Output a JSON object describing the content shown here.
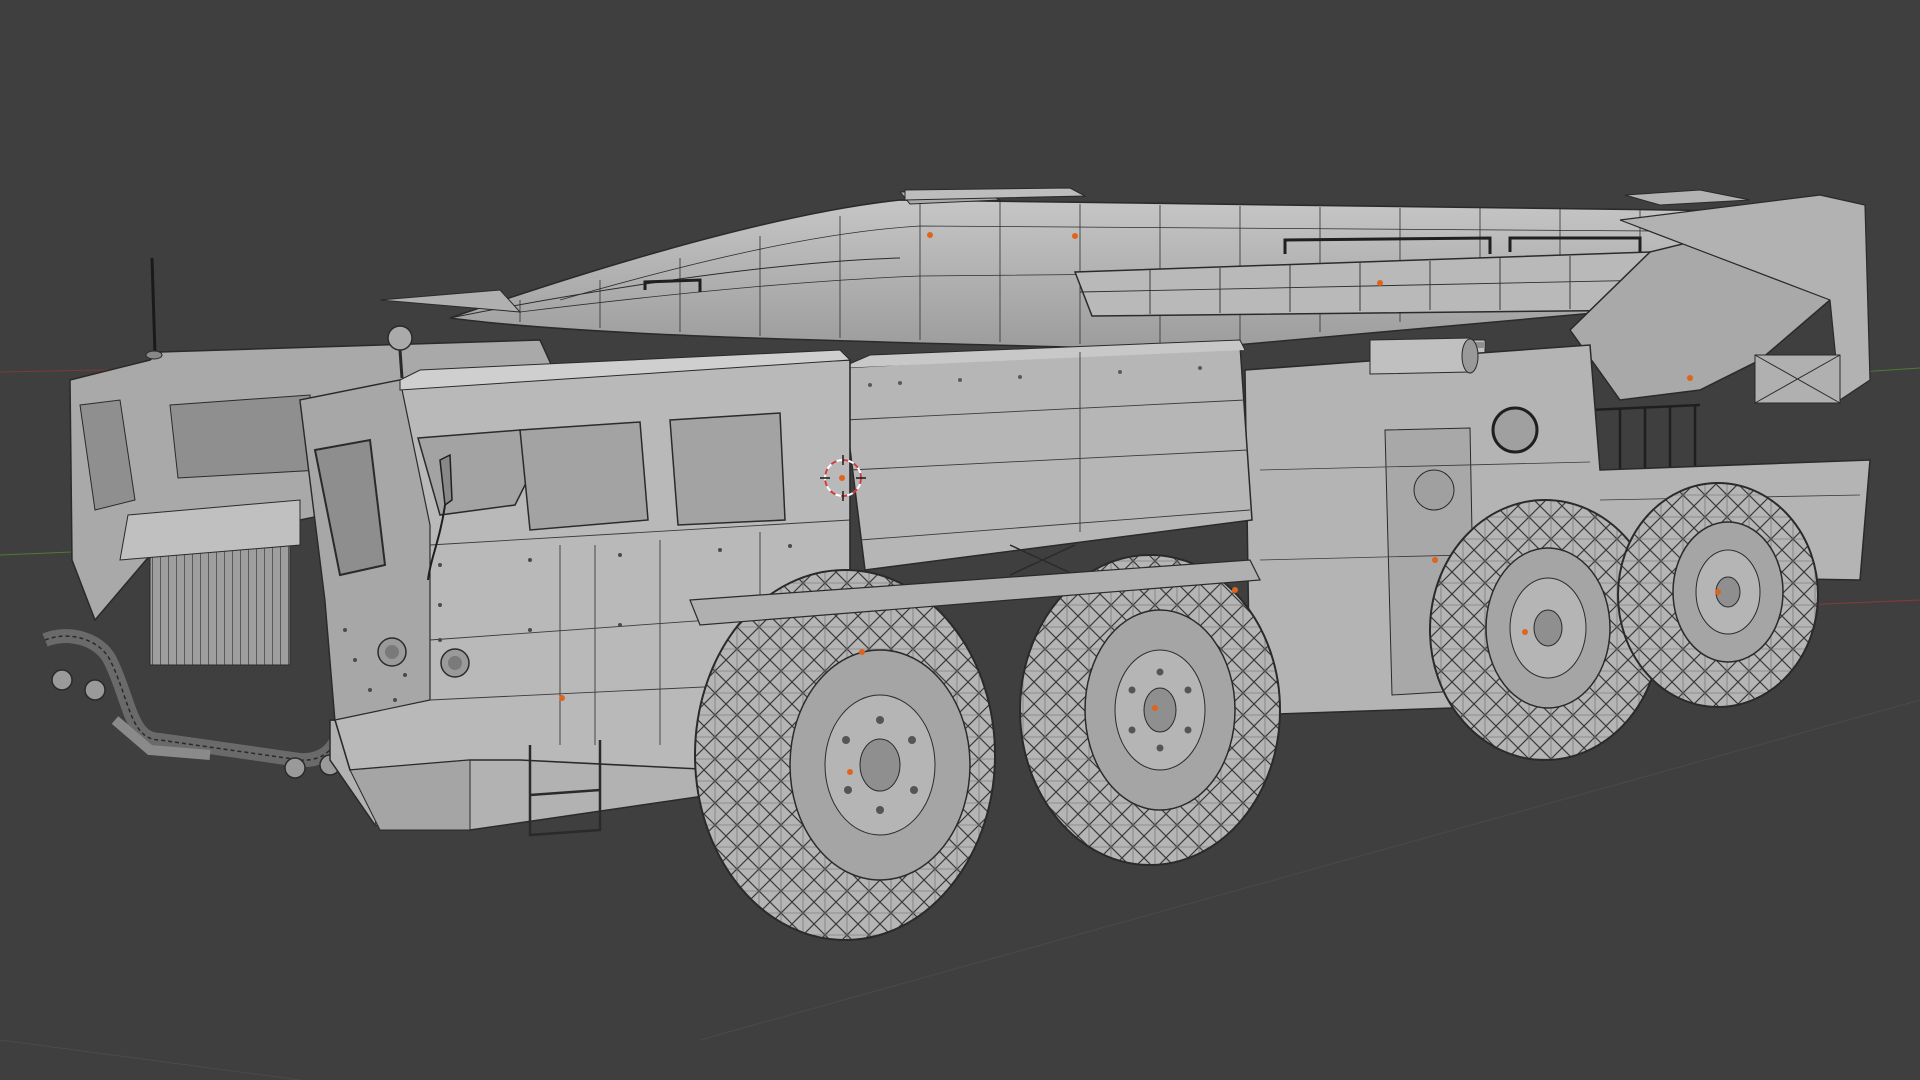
{
  "viewport": {
    "mode": "3D Viewport",
    "shading": "solid-wireframe-overlay",
    "grid": {
      "visible": true,
      "x_axis_color": "#8a3a3a",
      "y_axis_color": "#4e7a34"
    },
    "colors": {
      "background": "#3f3f3f",
      "mesh_light": "#bdbdbd",
      "mesh_mid": "#a7a7a7",
      "mesh_dark": "#8a8a8a",
      "wire": "#2a2a2a",
      "origin_dot": "#e0641e",
      "cursor_red": "#d23a3a"
    }
  },
  "scene": {
    "object": "mobile-launcher-truck-8x8",
    "parts": [
      "cab",
      "body",
      "missile",
      "erector-boom",
      "wheels"
    ],
    "wheel_count_visible": 4,
    "antenna": true,
    "tow_chain": true
  }
}
